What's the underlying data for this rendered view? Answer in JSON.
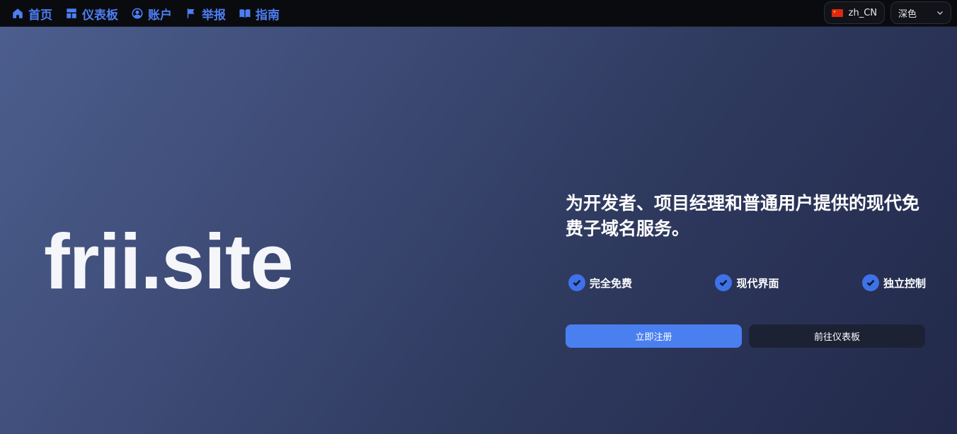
{
  "nav": {
    "items": [
      {
        "label": "首页",
        "icon": "home-icon"
      },
      {
        "label": "仪表板",
        "icon": "dashboard-icon"
      },
      {
        "label": "账户",
        "icon": "user-circle-icon"
      },
      {
        "label": "举报",
        "icon": "flag-icon"
      },
      {
        "label": "指南",
        "icon": "book-icon"
      }
    ]
  },
  "language": {
    "selected": "zh_CN",
    "icon": "china-flag-icon"
  },
  "theme": {
    "selected": "深色"
  },
  "hero": {
    "logo": "frii.site",
    "tagline": "为开发者、项目经理和普通用户提供的现代免费子域名服务。",
    "features": [
      {
        "label": "完全免费"
      },
      {
        "label": "现代界面"
      },
      {
        "label": "独立控制"
      }
    ],
    "primary_button": "立即注册",
    "secondary_button": "前往仪表板"
  },
  "colors": {
    "accent": "#4a7ff0",
    "nav_text": "#4d7ef2",
    "topbar_bg": "#0a0b0f",
    "hero_gradient_start": "#4c5e8e",
    "hero_gradient_end": "#22294a",
    "secondary_button_bg": "#1c2234"
  }
}
